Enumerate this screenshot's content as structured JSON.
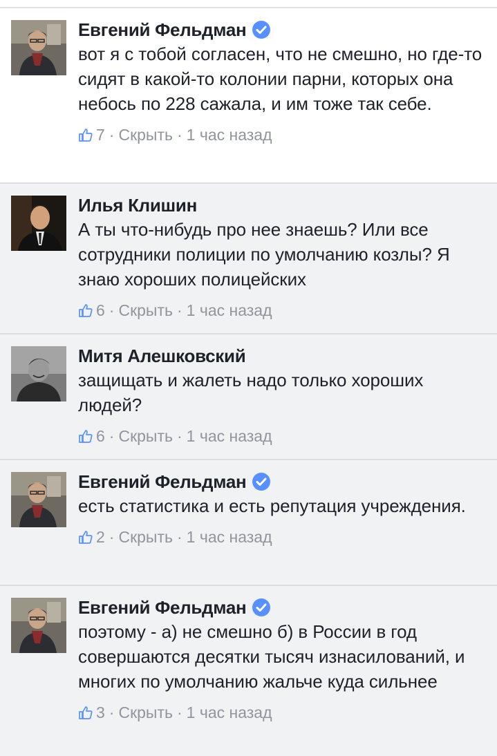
{
  "colors": {
    "verified": "#5890ff",
    "meta": "#90949c",
    "text": "#1d2129"
  },
  "comments": [
    {
      "author": "Евгений Фельдман",
      "verified": true,
      "text": "вот я с тобой согласен, что не смешно, но где-то сидят в какой-то колонии парни, которых она небось по 228 сажала, и им тоже так себе.",
      "likes": "7",
      "hide_label": "Скрыть",
      "time": "1 час назад"
    },
    {
      "author": "Илья Клишин",
      "verified": false,
      "text": "А ты что-нибудь про нее знаешь? Или все сотрудники полиции по умолчанию козлы? Я знаю хороших полицейских",
      "likes": "6",
      "hide_label": "Скрыть",
      "time": "1 час назад"
    },
    {
      "author": "Митя Алешковский",
      "verified": false,
      "text": "защищать и жалеть надо только хороших людей?",
      "likes": "6",
      "hide_label": "Скрыть",
      "time": "1 час назад"
    },
    {
      "author": "Евгений Фельдман",
      "verified": true,
      "text": "есть статистика и есть репутация учреждения.",
      "likes": "2",
      "hide_label": "Скрыть",
      "time": "1 час назад"
    },
    {
      "author": "Евгений Фельдман",
      "verified": true,
      "text": "поэтому - а) не смешно б) в России в год совершаются десятки тысяч изнасилований, и многих по умолчанию жальче куда сильнее",
      "likes": "3",
      "hide_label": "Скрыть",
      "time": "1 час назад"
    }
  ]
}
